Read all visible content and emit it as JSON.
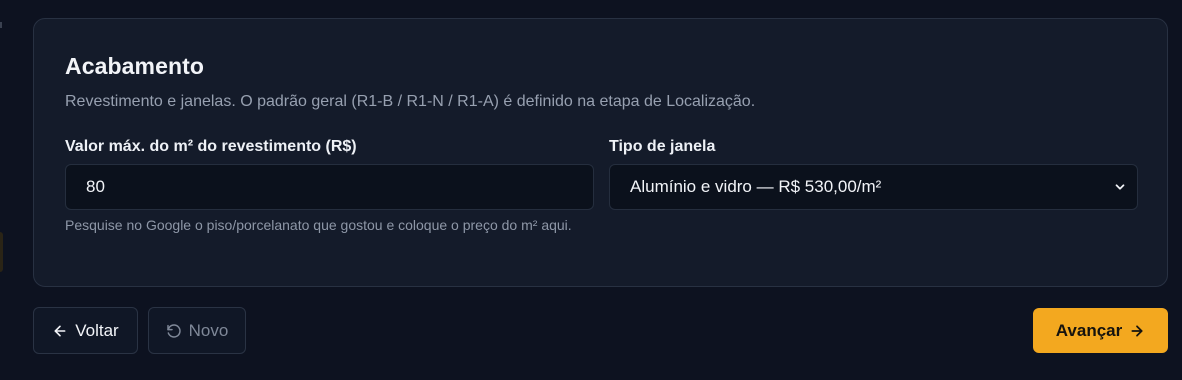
{
  "section": {
    "title": "Acabamento",
    "description": "Revestimento e janelas. O padrão geral (R1-B / R1-N / R1-A) é definido na etapa de Localização."
  },
  "fields": {
    "coating_price": {
      "label": "Valor máx. do m² do revestimento (R$)",
      "value": "80",
      "hint": "Pesquise no Google o piso/porcelanato que gostou e coloque o preço do m² aqui."
    },
    "window_type": {
      "label": "Tipo de janela",
      "selected": "Alumínio e vidro — R$ 530,00/m²"
    }
  },
  "buttons": {
    "back": "Voltar",
    "new": "Novo",
    "next": "Avançar"
  },
  "icons": {
    "back": "arrow-left-icon",
    "new": "rotate-ccw-icon",
    "next": "arrow-right-icon",
    "select": "chevron-down-icon"
  },
  "colors": {
    "background": "#0d1220",
    "card": "#141b2a",
    "accent": "#f3a81f"
  }
}
